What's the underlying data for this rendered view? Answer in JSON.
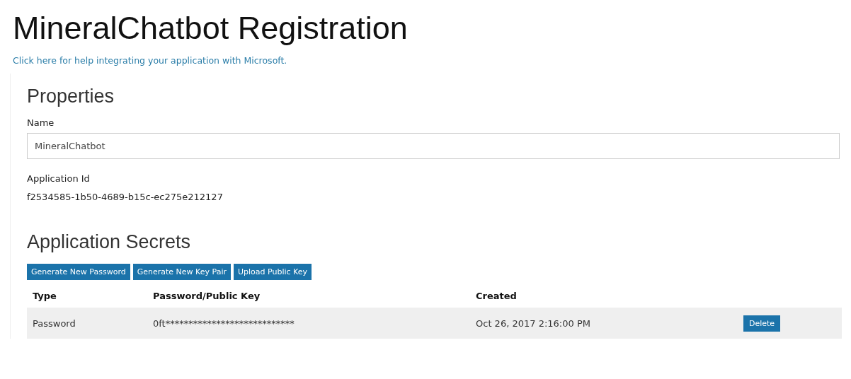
{
  "title": "MineralChatbot Registration",
  "help_link": "Click here for help integrating your application with Microsoft.",
  "properties": {
    "heading": "Properties",
    "name_label": "Name",
    "name_value": "MineralChatbot",
    "app_id_label": "Application Id",
    "app_id": "f2534585-1b50-4689-b15c-ec275e212127"
  },
  "secrets": {
    "heading": "Application Secrets",
    "buttons": [
      "Generate New Password",
      "Generate New Key Pair",
      "Upload Public Key"
    ],
    "columns": [
      "Type",
      "Password/Public Key",
      "Created"
    ],
    "rows": [
      {
        "type": "Password",
        "key": "0ft****************************",
        "created": "Oct 26, 2017 2:16:00 PM",
        "action": "Delete"
      }
    ]
  }
}
